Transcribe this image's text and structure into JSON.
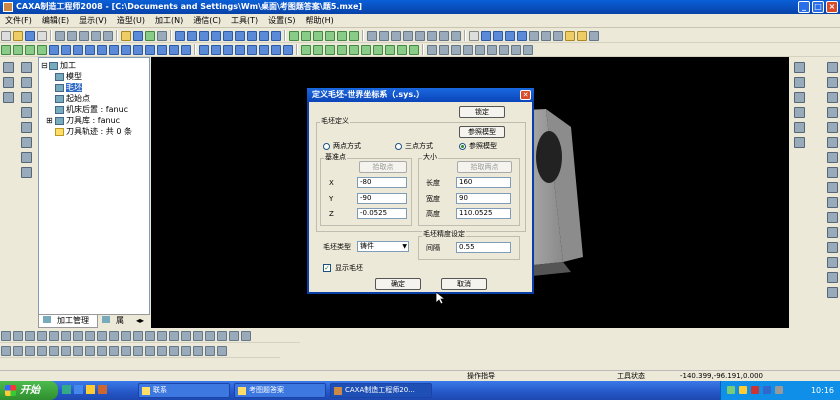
{
  "window": {
    "title": "CAXA制造工程师2008 - [C:\\Documents and Settings\\Wm\\桌面\\考图题答案\\题5.mxe]",
    "controls": [
      "_",
      "□",
      "×"
    ]
  },
  "menu": [
    "文件(F)",
    "编辑(E)",
    "显示(V)",
    "造型(U)",
    "加工(N)",
    "通信(C)",
    "工具(T)",
    "设置(S)",
    "帮助(H)"
  ],
  "tree": {
    "root": "加工",
    "items": [
      "模型",
      "毛坯",
      "起始点",
      "机床后置 : fanuc",
      "刀具库 : fanuc",
      "刀具轨迹 : 共 0 条"
    ],
    "selected_index": 1
  },
  "panel_tabs": [
    "加工管理",
    "属"
  ],
  "dialog": {
    "title": "定义毛坯-世界坐标系（.sys.）",
    "lock_button": "锁定",
    "group_blank_def": "毛坯定义",
    "ref_model_button": "参照模型",
    "modes": [
      "两点方式",
      "三点方式",
      "参照模型"
    ],
    "mode_selected": 2,
    "group_base": "基准点",
    "pick_point_button": "拾取点",
    "axes": [
      "X",
      "Y",
      "Z"
    ],
    "base_values": [
      "-80",
      "-90",
      "-0.0525"
    ],
    "group_size": "大小",
    "pick_two_points_button": "拾取两点",
    "size_labels": [
      "长度",
      "宽度",
      "高度"
    ],
    "size_values": [
      "160",
      "90",
      "110.0525"
    ],
    "type_label": "毛坯类型",
    "type_value": "铸件",
    "precision_group": "毛坯精度设定",
    "interval_label": "间隔",
    "interval_value": "0.55",
    "show_blank_label": "显示毛坯",
    "show_blank_checked": true,
    "ok_button": "确定",
    "cancel_button": "取消"
  },
  "status": {
    "prompt": "操作指导",
    "tool_state": "工具状态",
    "coords": "-140.399,-96.191,0.000"
  },
  "taskbar": {
    "start": "开始",
    "tasks": [
      "联系",
      "考图题答案",
      "CAXA制造工程师20..."
    ],
    "active_index": 2,
    "clock": "10:16"
  }
}
